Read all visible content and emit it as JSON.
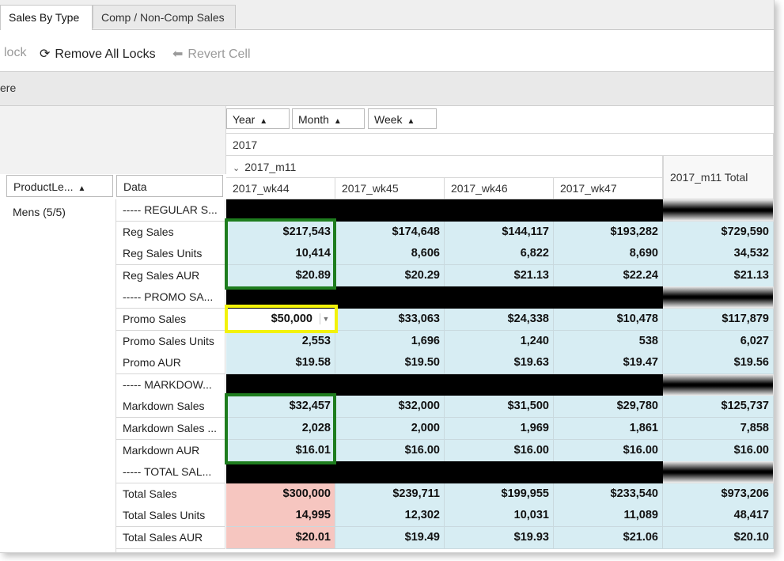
{
  "tabs": [
    {
      "label": "Sales By Type",
      "active": true
    },
    {
      "label": "Comp / Non-Comp Sales",
      "active": false
    }
  ],
  "toolbar": {
    "unlock": "lock",
    "remove_all_locks": "Remove All Locks",
    "revert_cell": "Revert Cell"
  },
  "filter_strip": "ere",
  "column_fields": [
    "Year",
    "Month",
    "Week"
  ],
  "row_fields": {
    "product_level": "ProductLe...",
    "data": "Data"
  },
  "year": "2017",
  "month": "2017_m11",
  "weeks": [
    "2017_wk44",
    "2017_wk45",
    "2017_wk46",
    "2017_wk47"
  ],
  "total_header": "2017_m11 Total",
  "product": "Mens (5/5)",
  "rows": [
    {
      "label": "----- REGULAR S...",
      "kind": "section",
      "values": [
        "",
        "",
        "",
        "",
        ""
      ]
    },
    {
      "label": "Reg Sales",
      "kind": "data",
      "values": [
        "$217,543",
        "$174,648",
        "$144,117",
        "$193,282",
        "$729,590"
      ]
    },
    {
      "label": "Reg Sales Units",
      "kind": "data",
      "values": [
        "10,414",
        "8,606",
        "6,822",
        "8,690",
        "34,532"
      ]
    },
    {
      "label": "Reg Sales AUR",
      "kind": "data",
      "values": [
        "$20.89",
        "$20.29",
        "$21.13",
        "$22.24",
        "$21.13"
      ]
    },
    {
      "label": "----- PROMO SA...",
      "kind": "section",
      "values": [
        "",
        "",
        "",
        "",
        ""
      ]
    },
    {
      "label": "Promo Sales",
      "kind": "data",
      "values": [
        "$50,000",
        "$33,063",
        "$24,338",
        "$10,478",
        "$117,879"
      ]
    },
    {
      "label": "Promo Sales Units",
      "kind": "data",
      "values": [
        "2,553",
        "1,696",
        "1,240",
        "538",
        "6,027"
      ]
    },
    {
      "label": "Promo AUR",
      "kind": "data",
      "values": [
        "$19.58",
        "$19.50",
        "$19.63",
        "$19.47",
        "$19.56"
      ]
    },
    {
      "label": "----- MARKDOW...",
      "kind": "section",
      "values": [
        "",
        "",
        "",
        "",
        ""
      ]
    },
    {
      "label": "Markdown Sales",
      "kind": "data",
      "values": [
        "$32,457",
        "$32,000",
        "$31,500",
        "$29,780",
        "$125,737"
      ]
    },
    {
      "label": "Markdown Sales ...",
      "kind": "data",
      "values": [
        "2,028",
        "2,000",
        "1,969",
        "1,861",
        "7,858"
      ]
    },
    {
      "label": "Markdown AUR",
      "kind": "data",
      "values": [
        "$16.01",
        "$16.00",
        "$16.00",
        "$16.00",
        "$16.00"
      ]
    },
    {
      "label": "----- TOTAL SAL...",
      "kind": "section",
      "values": [
        "",
        "",
        "",
        "",
        ""
      ]
    },
    {
      "label": "Total Sales",
      "kind": "total",
      "values": [
        "$300,000",
        "$239,711",
        "$199,955",
        "$233,540",
        "$973,206"
      ]
    },
    {
      "label": "Total Sales Units",
      "kind": "total",
      "values": [
        "14,995",
        "12,302",
        "10,031",
        "11,089",
        "48,417"
      ]
    },
    {
      "label": "Total Sales AUR",
      "kind": "total",
      "values": [
        "$20.01",
        "$19.49",
        "$19.93",
        "$21.06",
        "$20.10"
      ]
    }
  ],
  "colors": {
    "cell_bg": "#d7edf3",
    "total_wk44_bg": "#f6c6c0",
    "green_highlight": "#1e7d1e",
    "yellow_highlight": "#f2f20a"
  }
}
